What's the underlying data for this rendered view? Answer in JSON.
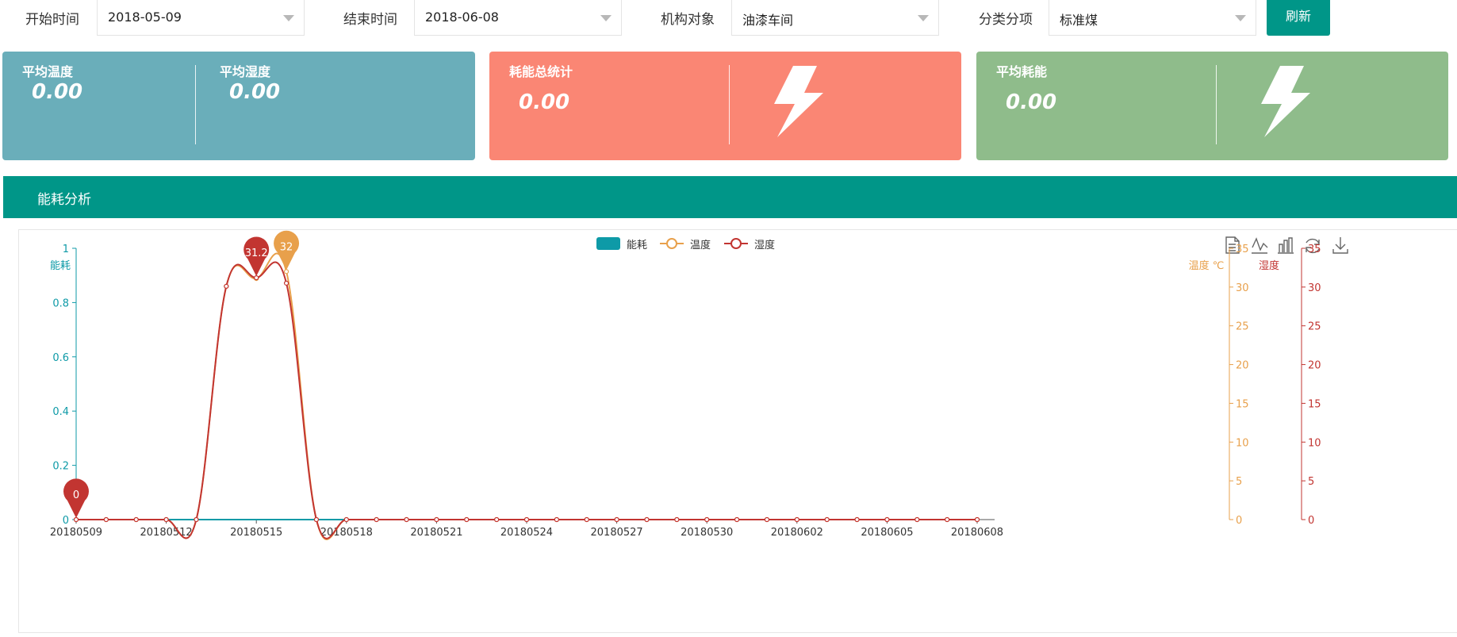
{
  "filters": {
    "start_label": "开始时间",
    "start_value": "2018-05-09",
    "end_label": "结束时间",
    "end_value": "2018-06-08",
    "org_label": "机构对象",
    "org_value": "油漆车间",
    "category_label": "分类分项",
    "category_value": "标准煤",
    "refresh_label": "刷新"
  },
  "cards": {
    "avg_temp_label": "平均温度",
    "avg_temp_value": "0.00",
    "avg_humidity_label": "平均湿度",
    "avg_humidity_value": "0.00",
    "total_energy_label": "耗能总统计",
    "total_energy_value": "0.00",
    "avg_energy_label": "平均耗能",
    "avg_energy_value": "0.00",
    "colors": {
      "blue": "#6aaeba",
      "red": "#fa8674",
      "green": "#8fbc8b"
    },
    "icon": "lightning-bolt-icon"
  },
  "panel": {
    "title": "能耗分析"
  },
  "toolbox": [
    "data-view-icon",
    "line-chart-icon",
    "bar-chart-icon",
    "restore-icon",
    "download-icon"
  ],
  "chart_data": {
    "type": "line",
    "legend": [
      "能耗",
      "温度",
      "湿度"
    ],
    "colors": {
      "energy": "#0e9aa7",
      "temp": "#e8a04b",
      "humidity": "#c23531",
      "axis": "#0e9aa7"
    },
    "x": [
      "20180509",
      "20180510",
      "20180511",
      "20180512",
      "20180513",
      "20180514",
      "20180515",
      "20180516",
      "20180517",
      "20180518",
      "20180519",
      "20180520",
      "20180521",
      "20180522",
      "20180523",
      "20180524",
      "20180525",
      "20180526",
      "20180527",
      "20180528",
      "20180529",
      "20180530",
      "20180531",
      "20180601",
      "20180602",
      "20180603",
      "20180604",
      "20180605",
      "20180606",
      "20180607",
      "20180608"
    ],
    "x_tick_labels": [
      "20180509",
      "20180512",
      "20180515",
      "20180518",
      "20180521",
      "20180524",
      "20180527",
      "20180530",
      "20180602",
      "20180605",
      "20180608"
    ],
    "y_left": {
      "label": "能耗",
      "min": 0,
      "max": 1,
      "ticks": [
        "0",
        "0.2",
        "0.4",
        "0.6",
        "0.8",
        "1"
      ]
    },
    "y_right1": {
      "label": "温度 ℃",
      "min": 0,
      "max": 35,
      "ticks": [
        "0",
        "5",
        "10",
        "15",
        "20",
        "25",
        "30",
        "35"
      ]
    },
    "y_right2": {
      "label": "湿度",
      "min": 0,
      "max": 35,
      "ticks": [
        "0",
        "5",
        "10",
        "15",
        "20",
        "25",
        "30",
        "35"
      ]
    },
    "series": [
      {
        "name": "能耗",
        "values": [
          0,
          0,
          0,
          0,
          0,
          0,
          0,
          0,
          0,
          0,
          0,
          0,
          0,
          0,
          0,
          0,
          0,
          0,
          0,
          0,
          0,
          0,
          0,
          0,
          0,
          0,
          0,
          0,
          0,
          0,
          0
        ]
      },
      {
        "name": "温度",
        "values": [
          0,
          0,
          0,
          0,
          0,
          30.1,
          31.1,
          32,
          0,
          0,
          0,
          0,
          0,
          0,
          0,
          0,
          0,
          0,
          0,
          0,
          0,
          0,
          0,
          0,
          0,
          0,
          0,
          0,
          0,
          0,
          0
        ]
      },
      {
        "name": "湿度",
        "values": [
          0,
          0,
          0,
          0,
          0,
          30.1,
          31.2,
          30.5,
          0,
          0,
          0,
          0,
          0,
          0,
          0,
          0,
          0,
          0,
          0,
          0,
          0,
          0,
          0,
          0,
          0,
          0,
          0,
          0,
          0,
          0,
          0
        ]
      }
    ],
    "markers": [
      {
        "series": "湿度",
        "label": "31.2",
        "index": 6,
        "value": 31.2
      },
      {
        "series": "温度",
        "label": "32",
        "index": 7,
        "value": 32
      },
      {
        "series": "湿度",
        "label": "0",
        "index": 0,
        "value": 0
      }
    ]
  }
}
